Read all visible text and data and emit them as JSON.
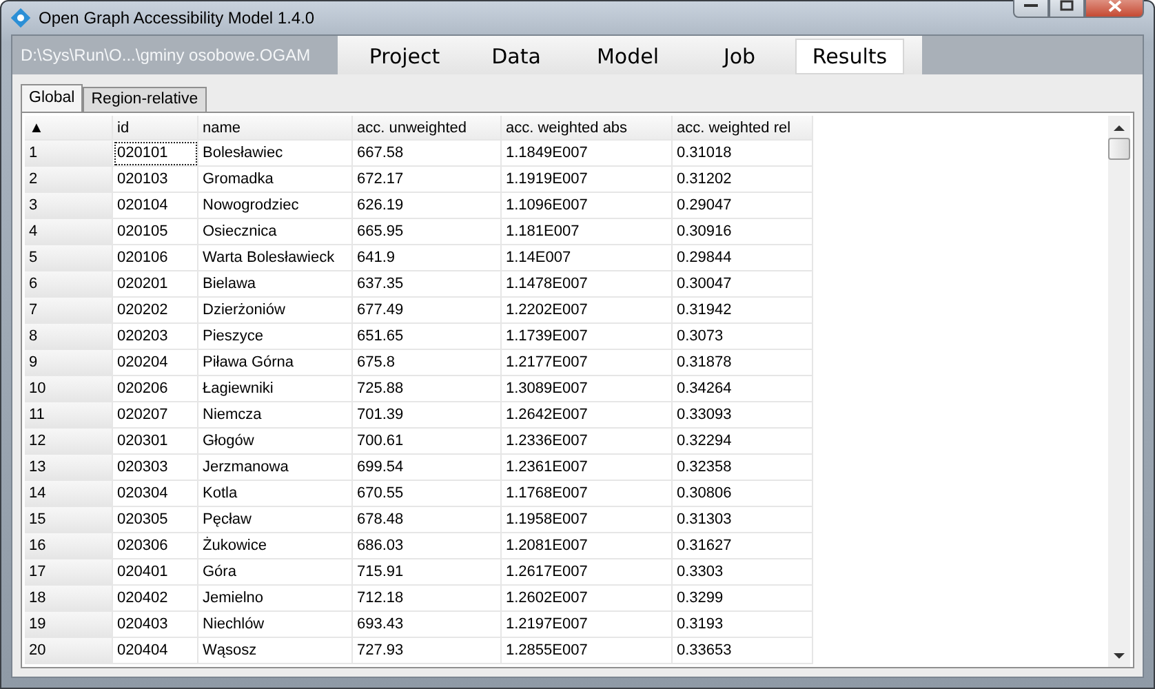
{
  "window": {
    "title": "Open Graph Accessibility Model 1.4.0"
  },
  "project_path": "D:\\Sys\\Run\\O...\\gminy osobowe.OGAM",
  "main_tabs": [
    {
      "label": "Project",
      "selected": false
    },
    {
      "label": "Data",
      "selected": false
    },
    {
      "label": "Model",
      "selected": false
    },
    {
      "label": "Job",
      "selected": false
    },
    {
      "label": "Results",
      "selected": true
    }
  ],
  "sub_tabs": [
    {
      "label": "Global",
      "selected": true
    },
    {
      "label": "Region-relative",
      "selected": false
    }
  ],
  "table": {
    "sort_indicator": "▲",
    "columns": [
      "id",
      "name",
      "acc. unweighted",
      "acc. weighted abs",
      "acc. weighted rel"
    ],
    "rows": [
      {
        "index": "1",
        "focused": true,
        "cells": [
          "020101",
          "Bolesławiec",
          "667.58",
          "1.1849E007",
          "0.31018"
        ]
      },
      {
        "index": "2",
        "focused": false,
        "cells": [
          "020103",
          "Gromadka",
          "672.17",
          "1.1919E007",
          "0.31202"
        ]
      },
      {
        "index": "3",
        "focused": false,
        "cells": [
          "020104",
          "Nowogrodziec",
          "626.19",
          "1.1096E007",
          "0.29047"
        ]
      },
      {
        "index": "4",
        "focused": false,
        "cells": [
          "020105",
          "Osiecznica",
          "665.95",
          "1.181E007",
          "0.30916"
        ]
      },
      {
        "index": "5",
        "focused": false,
        "cells": [
          "020106",
          "Warta Bolesławieck",
          "641.9",
          "1.14E007",
          "0.29844"
        ]
      },
      {
        "index": "6",
        "focused": false,
        "cells": [
          "020201",
          "Bielawa",
          "637.35",
          "1.1478E007",
          "0.30047"
        ]
      },
      {
        "index": "7",
        "focused": false,
        "cells": [
          "020202",
          "Dzierżoniów",
          "677.49",
          "1.2202E007",
          "0.31942"
        ]
      },
      {
        "index": "8",
        "focused": false,
        "cells": [
          "020203",
          "Pieszyce",
          "651.65",
          "1.1739E007",
          "0.3073"
        ]
      },
      {
        "index": "9",
        "focused": false,
        "cells": [
          "020204",
          "Piława Górna",
          "675.8",
          "1.2177E007",
          "0.31878"
        ]
      },
      {
        "index": "10",
        "focused": false,
        "cells": [
          "020206",
          "Łagiewniki",
          "725.88",
          "1.3089E007",
          "0.34264"
        ]
      },
      {
        "index": "11",
        "focused": false,
        "cells": [
          "020207",
          "Niemcza",
          "701.39",
          "1.2642E007",
          "0.33093"
        ]
      },
      {
        "index": "12",
        "focused": false,
        "cells": [
          "020301",
          "Głogów",
          "700.61",
          "1.2336E007",
          "0.32294"
        ]
      },
      {
        "index": "13",
        "focused": false,
        "cells": [
          "020303",
          "Jerzmanowa",
          "699.54",
          "1.2361E007",
          "0.32358"
        ]
      },
      {
        "index": "14",
        "focused": false,
        "cells": [
          "020304",
          "Kotla",
          "670.55",
          "1.1768E007",
          "0.30806"
        ]
      },
      {
        "index": "15",
        "focused": false,
        "cells": [
          "020305",
          "Pęcław",
          "678.48",
          "1.1958E007",
          "0.31303"
        ]
      },
      {
        "index": "16",
        "focused": false,
        "cells": [
          "020306",
          "Żukowice",
          "686.03",
          "1.2081E007",
          "0.31627"
        ]
      },
      {
        "index": "17",
        "focused": false,
        "cells": [
          "020401",
          "Góra",
          "715.91",
          "1.2617E007",
          "0.3303"
        ]
      },
      {
        "index": "18",
        "focused": false,
        "cells": [
          "020402",
          "Jemielno",
          "712.18",
          "1.2602E007",
          "0.3299"
        ]
      },
      {
        "index": "19",
        "focused": false,
        "cells": [
          "020403",
          "Niechlów",
          "693.43",
          "1.2197E007",
          "0.3193"
        ]
      },
      {
        "index": "20",
        "focused": false,
        "cells": [
          "020404",
          "Wąsosz",
          "727.93",
          "1.2855E007",
          "0.33653"
        ]
      }
    ]
  }
}
